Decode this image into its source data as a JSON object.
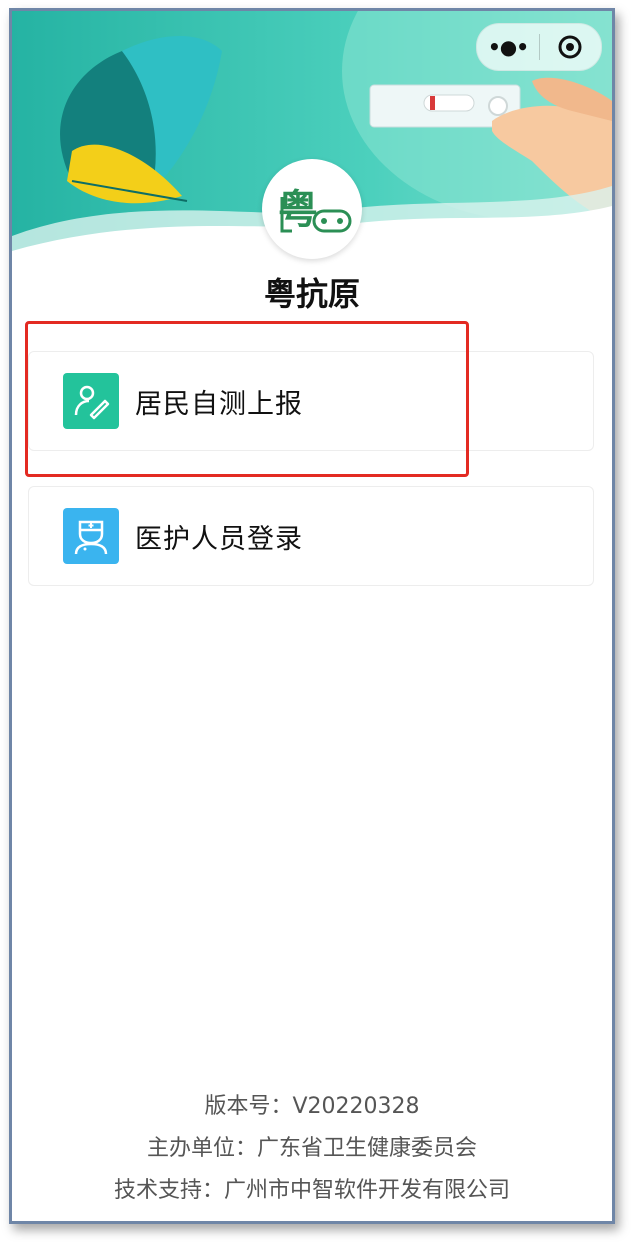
{
  "app": {
    "title": "粤抗原",
    "logo_text": "粤"
  },
  "capsule": {
    "more_icon": "more-dots-icon",
    "close_icon": "target-circle-icon"
  },
  "menu": [
    {
      "label": "居民自测上报",
      "icon": "person-edit-icon",
      "color": "#23c39b",
      "highlighted": true
    },
    {
      "label": "医护人员登录",
      "icon": "nurse-icon",
      "color": "#3ab4ef",
      "highlighted": false
    }
  ],
  "footer": {
    "version": "版本号：V20220328",
    "organizer": "主办单位：广东省卫生健康委员会",
    "support": "技术支持：广州市中智软件开发有限公司"
  },
  "colors": {
    "banner_teal": "#39c3b1",
    "banner_dark": "#1a8f86",
    "accent_yellow": "#f4d21b",
    "highlight_red": "#e32a22"
  }
}
